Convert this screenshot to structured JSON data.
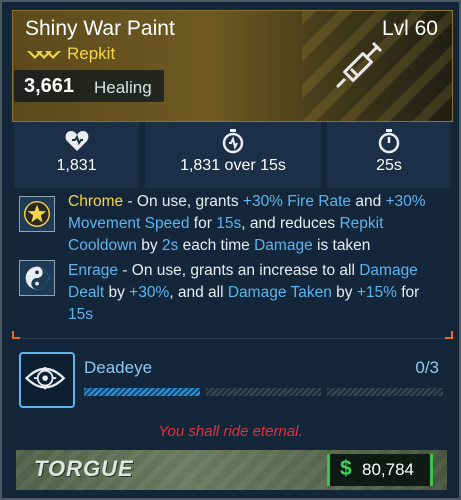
{
  "item": {
    "name": "Shiny War Paint",
    "level": "Lvl 60",
    "type": "Repkit",
    "primary_stat_value": "3,661",
    "primary_stat_label": "Healing",
    "rarity_icon": "rarity-chevrons-icon",
    "item_icon": "syringe-icon"
  },
  "stats": [
    {
      "icon": "heart-icon",
      "value": "1,831"
    },
    {
      "icon": "timer-heal-icon",
      "value": "1,831 over 15s"
    },
    {
      "icon": "stopwatch-icon",
      "value": "25s"
    }
  ],
  "perks": [
    {
      "icon": "chrome-star-icon",
      "segments": [
        {
          "t": "Chrome",
          "c": "y"
        },
        {
          "t": " - On use, grants ",
          "c": ""
        },
        {
          "t": "+30% Fire Rate",
          "c": "b"
        },
        {
          "t": " and ",
          "c": ""
        },
        {
          "t": "+30% Movement Speed",
          "c": "b"
        },
        {
          "t": " for ",
          "c": ""
        },
        {
          "t": "15s",
          "c": "b"
        },
        {
          "t": ", and reduces ",
          "c": ""
        },
        {
          "t": "Repkit Cooldown",
          "c": "b"
        },
        {
          "t": " by ",
          "c": ""
        },
        {
          "t": "2s",
          "c": "b"
        },
        {
          "t": " each time ",
          "c": ""
        },
        {
          "t": "Damage",
          "c": "b"
        },
        {
          "t": " is taken",
          "c": ""
        }
      ]
    },
    {
      "icon": "enrage-yinyang-icon",
      "segments": [
        {
          "t": "Enrage",
          "c": "b"
        },
        {
          "t": " - On use, grants an increase to all ",
          "c": ""
        },
        {
          "t": "Damage Dealt",
          "c": "b"
        },
        {
          "t": " by ",
          "c": ""
        },
        {
          "t": "+30%",
          "c": "b"
        },
        {
          "t": ", and all ",
          "c": ""
        },
        {
          "t": "Damage Taken",
          "c": "b"
        },
        {
          "t": " by ",
          "c": ""
        },
        {
          "t": "+15%",
          "c": "b"
        },
        {
          "t": " for ",
          "c": ""
        },
        {
          "t": "15s",
          "c": "b"
        }
      ]
    }
  ],
  "challenge": {
    "icon": "deadeye-eye-icon",
    "name": "Deadeye",
    "progress": "0/3",
    "segments_total": 3,
    "segments_filled": 1
  },
  "flavor_text": "You shall ride eternal.",
  "manufacturer": "TORGUE",
  "price": {
    "icon": "dollar-icon",
    "currency_symbol": "$",
    "value": "80,784"
  },
  "colors": {
    "yellow_highlight": "#f6d54a",
    "blue_highlight": "#5fb4ee",
    "flavor_red": "#e2303c",
    "price_green": "#3fd55b"
  }
}
